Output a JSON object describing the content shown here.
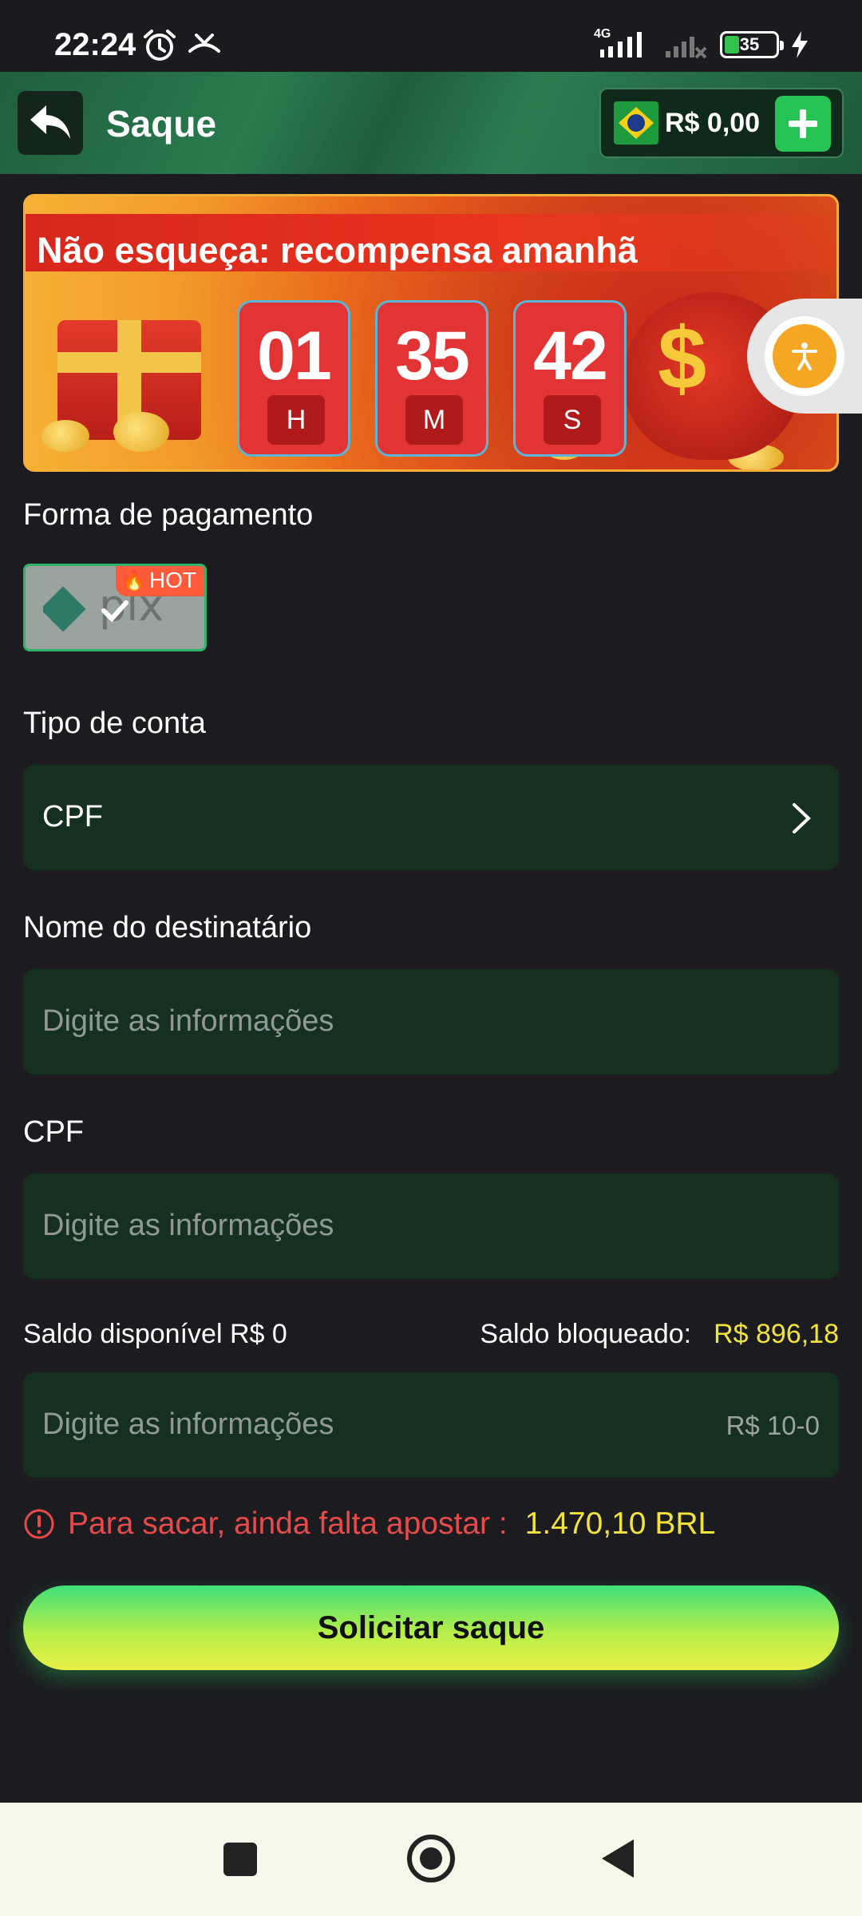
{
  "status_bar": {
    "time": "22:24",
    "network": "4G",
    "battery": "35"
  },
  "header": {
    "title": "Saque",
    "balance": "R$ 0,00"
  },
  "banner": {
    "text": "Não esqueça: recompensa amanhã",
    "timer": [
      {
        "value": "01",
        "unit": "H"
      },
      {
        "value": "35",
        "unit": "M"
      },
      {
        "value": "42",
        "unit": "S"
      }
    ]
  },
  "payment": {
    "label": "Forma de pagamento",
    "method": "pix",
    "badge": "HOT"
  },
  "account_type": {
    "label": "Tipo de conta",
    "value": "CPF"
  },
  "recipient": {
    "label": "Nome do destinatário",
    "placeholder": "Digite as informações"
  },
  "cpf": {
    "label": "CPF",
    "placeholder": "Digite as informações"
  },
  "balance": {
    "available": "Saldo disponível R$ 0",
    "blocked_label": "Saldo bloqueado:",
    "blocked_value": "R$ 896,18"
  },
  "amount": {
    "placeholder": "Digite as informações",
    "hint": "R$ 10-0"
  },
  "warning": {
    "text": "Para sacar, ainda falta apostar :",
    "value": "1.470,10 BRL"
  },
  "submit_label": "Solicitar saque",
  "colors": {
    "background": "#1c1c20",
    "header": "#236b46",
    "field": "#15301f",
    "accent_yellow": "#f0e33c",
    "warning_red": "#e84a4a",
    "hot_badge": "#ff5a3a"
  }
}
